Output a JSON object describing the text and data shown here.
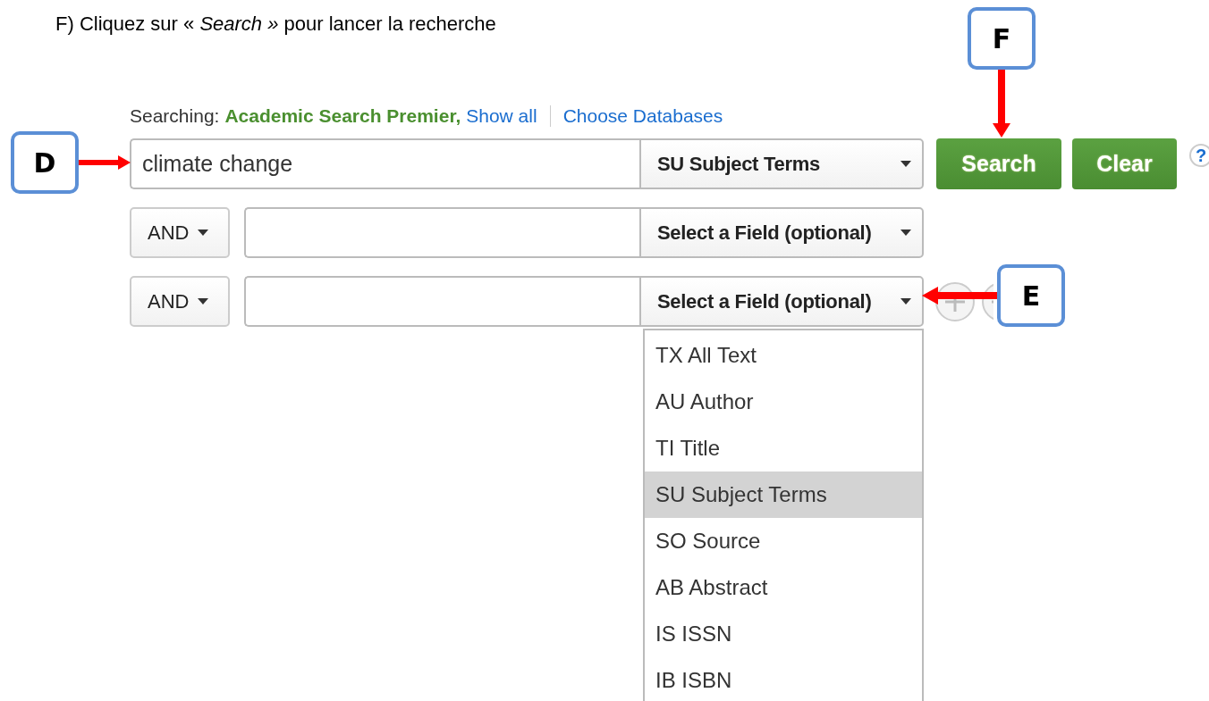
{
  "instruction": {
    "text": "F) Cliquez sur « *Search »* pour lancer la recherche"
  },
  "searching": {
    "label": "Searching:",
    "database": "Academic Search Premier,",
    "links": [
      "Show all",
      "Choose Databases"
    ]
  },
  "rows": [
    {
      "kind": "main",
      "value": "climate change",
      "field": "SU Subject Terms"
    },
    {
      "kind": "extra",
      "operator": "AND",
      "field": "Select a Field (optional)"
    },
    {
      "kind": "extra",
      "operator": "AND",
      "field": "Select a Field (optional)",
      "row_controls": true,
      "menu_open": true
    }
  ],
  "buttons": [
    "Search",
    "Clear"
  ],
  "help": "?",
  "field_menu": {
    "items": [
      {
        "label": "TX All Text",
        "selected": false
      },
      {
        "label": "AU Author",
        "selected": false
      },
      {
        "label": "TI Title",
        "selected": false
      },
      {
        "label": "SU Subject Terms",
        "selected": true
      },
      {
        "label": "SO Source",
        "selected": false
      },
      {
        "label": "AB Abstract",
        "selected": false
      },
      {
        "label": "IS ISSN",
        "selected": false
      },
      {
        "label": "IB ISBN",
        "selected": false
      }
    ]
  },
  "callouts": [
    {
      "label": "D",
      "kind": "right"
    },
    {
      "label": "F",
      "kind": "down"
    },
    {
      "label": "E",
      "kind": "left"
    }
  ]
}
